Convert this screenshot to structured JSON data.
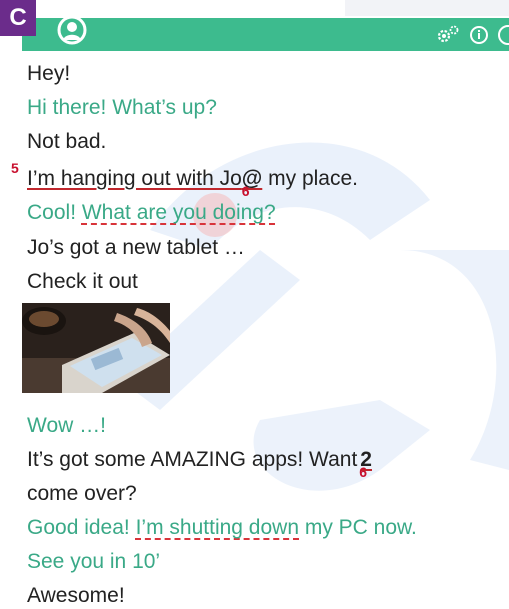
{
  "section_badge": "C",
  "header": {
    "avatar_icon": "user-avatar-icon",
    "icons": [
      "settings-gears-icon",
      "info-icon",
      "more-icon"
    ],
    "color": "#3dbb8e"
  },
  "messages": {
    "m1": "Hey!",
    "m2": "Hi there! What’s up?",
    "m3": "Not bad.",
    "m4_marker1": "5",
    "m4_part1": "I’m hanging out with Jo",
    "m4_marker2": "6",
    "m4_at": "@",
    "m4_part2": " my place.",
    "m5_part1": "Cool! ",
    "m5_part2": "What are you doing?",
    "m6": "Jo’s got a new tablet …",
    "m7": "Check it out",
    "m8": "Wow …!",
    "m9_part1": "It’s got some AMAZING apps! Want",
    "m9_marker": "6",
    "m9_num": "2",
    "m10": "come over?",
    "m11_part1": "Good idea! ",
    "m11_part2": "I’m shutting down",
    "m11_part3": " my PC now.",
    "m12": "See you in 10’",
    "m13": "Awesome!"
  },
  "colors": {
    "friend_text": "#3aa987",
    "me_text": "#222222",
    "marker": "#c8102e",
    "badge": "#6b2c8b"
  }
}
